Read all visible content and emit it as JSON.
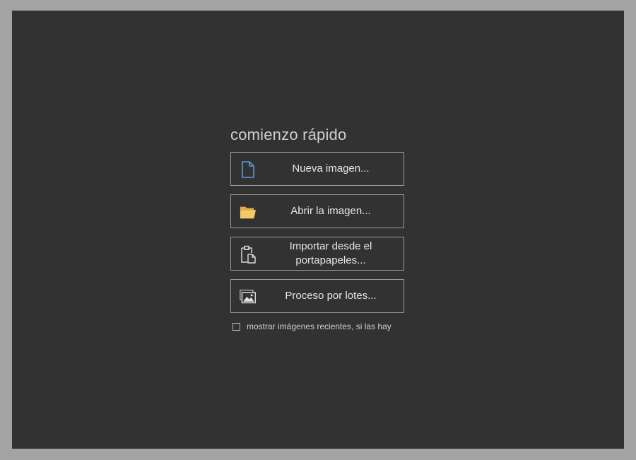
{
  "quick_start": {
    "title": "comienzo rápido",
    "actions": [
      {
        "label": "Nueva imagen...",
        "icon": "new-file-icon"
      },
      {
        "label": "Abrir la imagen...",
        "icon": "folder-icon"
      },
      {
        "label": "Importar desde el portapapeles...",
        "icon": "clipboard-icon"
      },
      {
        "label": "Proceso por lotes...",
        "icon": "image-batch-icon"
      }
    ],
    "recent_checkbox": {
      "label": "mostrar imágenes recientes, si las hay",
      "checked": false
    }
  },
  "colors": {
    "frame": "#a3a3a3",
    "panel": "#323232",
    "new_file_icon": "#5b9bd5",
    "folder_icon": "#f5c96a"
  }
}
